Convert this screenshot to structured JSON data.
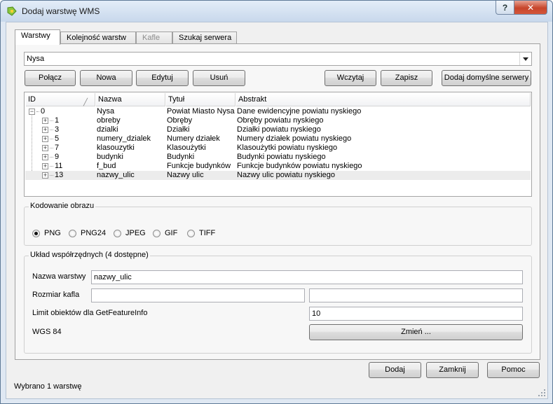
{
  "window": {
    "title": "Dodaj warstwę WMS",
    "help": "?",
    "close": "✕"
  },
  "tabs": [
    "Warstwy",
    "Kolejność warstw",
    "Kafle",
    "Szukaj serwera"
  ],
  "server": {
    "selected": "Nysa"
  },
  "buttons": {
    "connect": "Połącz",
    "new": "Nowa",
    "edit": "Edytuj",
    "delete": "Usuń",
    "load": "Wczytaj",
    "save": "Zapisz",
    "add_default": "Dodaj domyślne serwery"
  },
  "table": {
    "headers": [
      "ID",
      "Nazwa",
      "Tytuł",
      "Abstrakt"
    ],
    "rows": [
      {
        "id": "0",
        "name": "Nysa",
        "title": "Powiat Miasto Nysa",
        "abstract": "Dane ewidencyjne powiatu nyskiego"
      },
      {
        "id": "1",
        "name": "obreby",
        "title": "Obręby",
        "abstract": "Obręby powiatu nyskiego"
      },
      {
        "id": "3",
        "name": "dzialki",
        "title": "Działki",
        "abstract": "Działki powiatu nyskiego"
      },
      {
        "id": "5",
        "name": "numery_dzialek",
        "title": "Numery działek",
        "abstract": "Numery działek powiatu nyskiego"
      },
      {
        "id": "7",
        "name": "klasouzytki",
        "title": "Klasoużytki",
        "abstract": "Klasoużytki powiatu nyskiego"
      },
      {
        "id": "9",
        "name": "budynki",
        "title": "Budynki",
        "abstract": "Budynki powiatu nyskiego"
      },
      {
        "id": "11",
        "name": "f_bud",
        "title": "Funkcje budynków",
        "abstract": "Funkcje budynków powiatu nyskiego"
      },
      {
        "id": "13",
        "name": "nazwy_ulic",
        "title": "Nazwy ulic",
        "abstract": "Nazwy ulic powiatu nyskiego"
      }
    ]
  },
  "encoding": {
    "title": "Kodowanie obrazu",
    "options": [
      "PNG",
      "PNG24",
      "JPEG",
      "GIF",
      "TIFF"
    ],
    "selected": "PNG"
  },
  "crs": {
    "title": "Układ współrzędnych (4 dostępne)",
    "layer_name_label": "Nazwa warstwy",
    "layer_name_value": "nazwy_ulic",
    "tile_size_label": "Rozmiar kafla",
    "feature_limit_label": "Limit obiektów dla GetFeatureInfo",
    "feature_limit_value": "10",
    "crs_name": "WGS 84",
    "change_button": "Zmień ..."
  },
  "dialog_buttons": {
    "add": "Dodaj",
    "close": "Zamknij",
    "help": "Pomoc"
  },
  "status": "Wybrano 1 warstwę"
}
